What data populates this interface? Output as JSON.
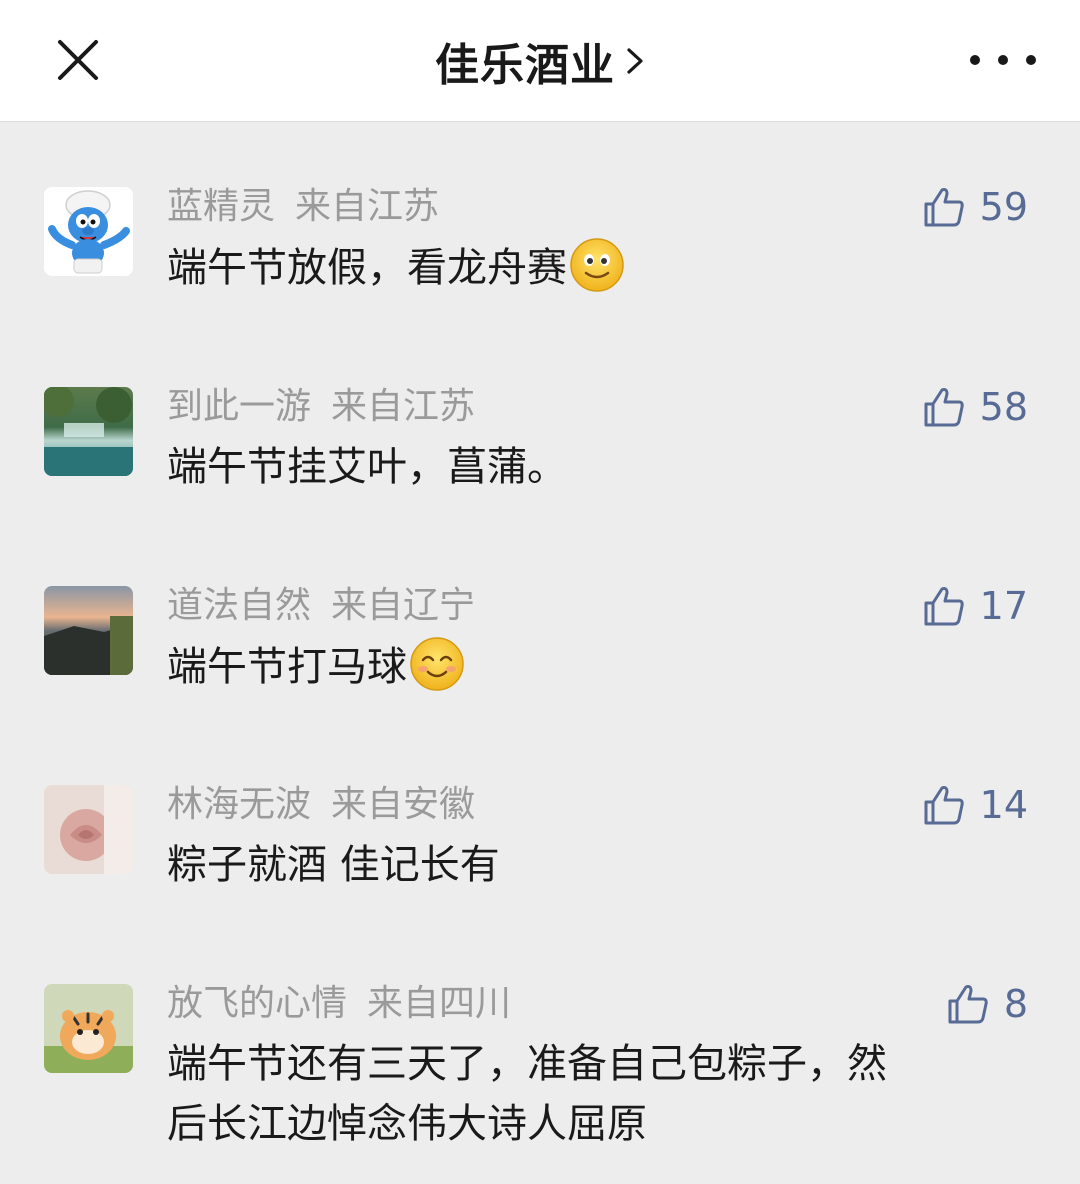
{
  "header": {
    "title": "佳乐酒业",
    "title_chevron": "›",
    "close_icon": "close-icon",
    "more_icon": "more-dots-icon",
    "background": "#ffffff"
  },
  "colors": {
    "page_background": "#ededed",
    "like_accent": "#576b95",
    "meta_text": "#9a9a9a",
    "body_text": "#1a1a1a"
  },
  "comments": [
    {
      "name": "蓝精灵",
      "location": "来自江苏",
      "text": "端午节放假，看龙舟赛",
      "emoji": "slightly-smiling-emoji",
      "likes": "59",
      "avatar": "smurf-avatar"
    },
    {
      "name": "到此一游",
      "location": "来自江苏",
      "text": "端午节挂艾叶，菖蒲。",
      "likes": "58",
      "avatar": "waterfall-landscape-avatar"
    },
    {
      "name": "道法自然",
      "location": "来自辽宁",
      "text": "端午节打马球",
      "emoji": "blushing-smile-emoji",
      "likes": "17",
      "avatar": "mountain-sunset-avatar"
    },
    {
      "name": "林海无波",
      "location": "来自安徽",
      "text": "粽子就酒 佳记长有",
      "likes": "14",
      "avatar": "pink-rose-avatar"
    },
    {
      "name": "放飞的心情",
      "location": "来自四川",
      "text_line1": "端午节还有三天了，准备自己包粽子，然",
      "text_line2": "后长江边悼念伟大诗人屈原",
      "likes": "8",
      "avatar": "tiger-cub-avatar"
    }
  ]
}
